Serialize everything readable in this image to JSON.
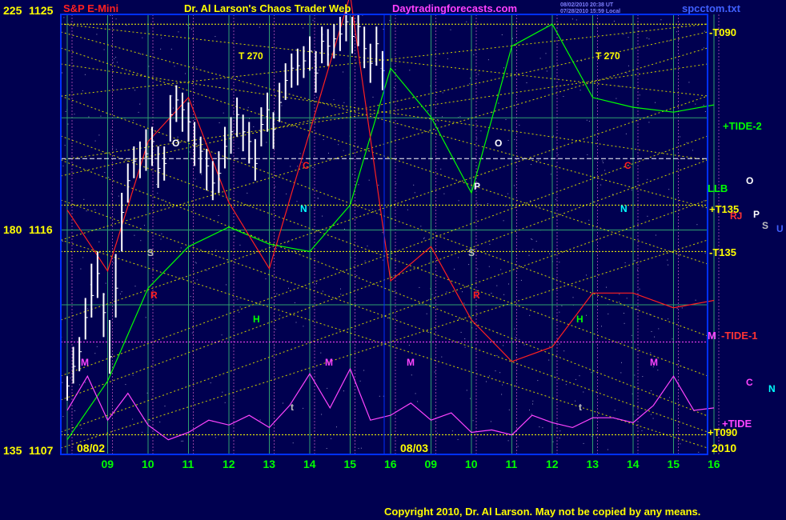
{
  "chart_data": {
    "type": "bar",
    "title": "Dr. Al Larson's Chaos Trader Web",
    "site": "Daytradingforecasts.com",
    "instrument": "S&P E-Mini",
    "file_name": "spcctom.txt",
    "header_timestamps": [
      "08/02/2010 20:38 UT",
      "07/28/2010 15:59 Local"
    ],
    "copyright": "Copyright 2010, Dr. Al Larson. May not be copied by any means.",
    "year": "2010",
    "date_labels": [
      "08/02",
      "08/03"
    ],
    "x_ticks": [
      "09",
      "10",
      "11",
      "12",
      "13",
      "14",
      "15",
      "16",
      "09",
      "10",
      "11",
      "12",
      "13",
      "14",
      "15",
      "16"
    ],
    "y_left_labels": [
      {
        "angle": "225",
        "price": 1125
      },
      {
        "angle": "180",
        "price": 1116
      },
      {
        "angle": "135",
        "price": 1107
      }
    ],
    "ylim": [
      1107,
      1125
    ],
    "right_labels": [
      {
        "text": "-T090",
        "color": "#ffff00"
      },
      {
        "text": "+TIDE-2",
        "color": "#00ff00"
      },
      {
        "text": "LLB",
        "color": "#00ff00"
      },
      {
        "text": "+T135",
        "color": "#ffff00"
      },
      {
        "text": "-T135",
        "color": "#ffff00"
      },
      {
        "text": "M",
        "color": "#ff44ff"
      },
      {
        "text": "-TIDE-1",
        "color": "#ff3333"
      },
      {
        "text": "+TIDE",
        "color": "#ff44ff"
      },
      {
        "text": "+T090",
        "color": "#ffff00"
      }
    ],
    "right_planet_glyphs": [
      {
        "text": "O",
        "color": "#ffffff"
      },
      {
        "text": "RJ",
        "color": "#ff3333"
      },
      {
        "text": "P",
        "color": "#ffffff"
      },
      {
        "text": "S",
        "color": "#c0c0c0"
      },
      {
        "text": "U",
        "color": "#4060ff"
      },
      {
        "text": "C",
        "color": "#ff44ff"
      },
      {
        "text": "N",
        "color": "#00ffff"
      }
    ],
    "plot_letters": [
      {
        "text": "T 270",
        "color": "#ffff00"
      },
      {
        "text": "T 270",
        "color": "#ffff00"
      },
      {
        "text": "O",
        "color": "#ffffff"
      },
      {
        "text": "O",
        "color": "#ffffff"
      },
      {
        "text": "C",
        "color": "#ff2020"
      },
      {
        "text": "C",
        "color": "#ff2020"
      },
      {
        "text": "N",
        "color": "#00ffff"
      },
      {
        "text": "N",
        "color": "#00ffff"
      },
      {
        "text": "S",
        "color": "#c0c0c0"
      },
      {
        "text": "S",
        "color": "#c0c0c0"
      },
      {
        "text": "P",
        "color": "#ffffff"
      },
      {
        "text": "R",
        "color": "#ff2020"
      },
      {
        "text": "R",
        "color": "#ff2020"
      },
      {
        "text": "H",
        "color": "#00ff00"
      },
      {
        "text": "H",
        "color": "#00ff00"
      },
      {
        "text": "M",
        "color": "#ff44ff"
      },
      {
        "text": "M",
        "color": "#ff44ff"
      },
      {
        "text": "M",
        "color": "#ff44ff"
      },
      {
        "text": "M",
        "color": "#ff44ff"
      },
      {
        "text": "t",
        "color": "#c0c0c0"
      },
      {
        "text": "t",
        "color": "#c0c0c0"
      }
    ],
    "price_series": {
      "name": "",
      "color": "#ffffff",
      "x": [
        0.0,
        0.15,
        0.3,
        0.45,
        0.6,
        0.75,
        0.9,
        1.05,
        1.2,
        1.35,
        1.5,
        1.65,
        1.8,
        1.95,
        2.1,
        2.25,
        2.4,
        2.55,
        2.7,
        2.85,
        3.0,
        3.15,
        3.3,
        3.45,
        3.6,
        3.75,
        3.9,
        4.05,
        4.2,
        4.35,
        4.5,
        4.65,
        4.8,
        4.95,
        5.1,
        5.25,
        5.4,
        5.55,
        5.7,
        5.85,
        6.0,
        6.15,
        6.3,
        6.45,
        6.6,
        6.75,
        6.9,
        7.05,
        7.2,
        7.35,
        7.5,
        7.65,
        7.8
      ],
      "close": [
        1109.8,
        1110.6,
        1111.2,
        1112.6,
        1113.5,
        1114.4,
        1112.8,
        1111.0,
        1113.8,
        1116.9,
        1118.2,
        1119.0,
        1119.1,
        1119.3,
        1119.8,
        1118.7,
        1118.9,
        1120.9,
        1121.5,
        1121.1,
        1120.6,
        1119.7,
        1119.4,
        1118.8,
        1118.1,
        1118.5,
        1119.6,
        1120.2,
        1120.9,
        1120.2,
        1119.8,
        1118.9,
        1120.5,
        1121.1,
        1120.3,
        1121.4,
        1122.3,
        1122.8,
        1122.9,
        1123.1,
        1123.5,
        1122.6,
        1123.9,
        1123.7,
        1124.0,
        1124.2,
        1124.7,
        1124.1,
        1124.5,
        1123.6,
        1123.0,
        1123.8,
        1122.7
      ],
      "high": [
        1110.2,
        1111.4,
        1111.8,
        1113.4,
        1114.8,
        1115.3,
        1113.6,
        1112.5,
        1115.2,
        1117.7,
        1118.9,
        1119.6,
        1119.8,
        1120.3,
        1120.4,
        1119.6,
        1119.6,
        1121.7,
        1122.1,
        1121.8,
        1121.4,
        1120.6,
        1120.0,
        1119.5,
        1119.0,
        1119.4,
        1120.4,
        1120.8,
        1121.6,
        1120.9,
        1120.6,
        1119.9,
        1121.2,
        1121.8,
        1121.0,
        1122.2,
        1123.0,
        1123.4,
        1123.6,
        1123.7,
        1124.1,
        1123.5,
        1124.5,
        1124.4,
        1124.6,
        1124.9,
        1125.3,
        1124.9,
        1125.0,
        1124.5,
        1123.8,
        1124.5,
        1123.5
      ],
      "low": [
        1109.2,
        1109.9,
        1110.4,
        1111.7,
        1112.6,
        1113.4,
        1111.8,
        1110.3,
        1112.6,
        1115.3,
        1117.3,
        1118.3,
        1118.3,
        1118.6,
        1118.8,
        1117.9,
        1118.2,
        1119.8,
        1120.6,
        1120.2,
        1119.8,
        1118.8,
        1118.5,
        1117.8,
        1117.4,
        1117.7,
        1118.7,
        1119.3,
        1120.0,
        1119.4,
        1118.9,
        1118.2,
        1119.6,
        1120.2,
        1119.5,
        1120.6,
        1121.5,
        1122.0,
        1122.1,
        1122.4,
        1122.7,
        1121.8,
        1123.0,
        1122.9,
        1123.2,
        1123.5,
        1123.9,
        1123.4,
        1123.7,
        1122.8,
        1122.2,
        1122.9,
        1121.9
      ]
    },
    "series": [
      {
        "name": "+TIDE-2",
        "color": "#00ff00",
        "x": [
          0,
          1,
          2,
          3,
          4,
          5,
          6,
          7,
          8,
          9,
          10,
          11,
          12,
          13,
          14,
          15,
          16
        ],
        "y": [
          1107.6,
          1110.0,
          1113.8,
          1115.5,
          1116.3,
          1115.6,
          1115.3,
          1117.2,
          1122.8,
          1120.8,
          1117.7,
          1123.7,
          1124.6,
          1121.6,
          1121.2,
          1121.0,
          1121.3
        ]
      },
      {
        "name": "-TIDE-1",
        "color": "#ff2020",
        "x": [
          0,
          1,
          2,
          3,
          4,
          5,
          6,
          7,
          8,
          9,
          10,
          11,
          12,
          13,
          14,
          15,
          16
        ],
        "y": [
          1117.0,
          1114.5,
          1119.8,
          1121.6,
          1117.3,
          1114.6,
          1120.2,
          1125.8,
          1114.1,
          1115.5,
          1112.5,
          1110.8,
          1111.4,
          1113.6,
          1113.6,
          1113.0,
          1113.3
        ]
      },
      {
        "name": "+TIDE",
        "color": "#ff44ff",
        "x": [
          0,
          0.5,
          1,
          1.5,
          2,
          2.5,
          3,
          3.5,
          4,
          4.5,
          5,
          5.5,
          6,
          6.5,
          7,
          7.5,
          8,
          8.5,
          9,
          9.5,
          10,
          10.5,
          11,
          11.5,
          12,
          12.5,
          13,
          13.5,
          14,
          14.5,
          15,
          15.5,
          16
        ],
        "y": [
          1108.8,
          1110.2,
          1108.4,
          1109.5,
          1108.2,
          1107.6,
          1107.9,
          1108.4,
          1108.2,
          1108.6,
          1108.1,
          1109.0,
          1110.3,
          1108.9,
          1110.5,
          1108.4,
          1108.6,
          1109.1,
          1108.4,
          1108.7,
          1107.9,
          1108.0,
          1107.8,
          1108.6,
          1108.3,
          1108.1,
          1108.5,
          1108.5,
          1108.3,
          1109.0,
          1110.2,
          1108.8,
          1108.9
        ]
      }
    ],
    "level_lines": [
      {
        "name": "-T090",
        "price": 1124.6,
        "color": "#ffff00",
        "style": "dotted"
      },
      {
        "name": "LLB",
        "price": 1119.1,
        "color": "#ffffff",
        "style": "dashed"
      },
      {
        "name": "+T135",
        "price": 1117.2,
        "color": "#ffff00",
        "style": "dotted"
      },
      {
        "name": "-T135",
        "price": 1115.3,
        "color": "#ffff00",
        "style": "dotted"
      },
      {
        "name": "M",
        "price": 1111.6,
        "color": "#ff44ff",
        "style": "dotted"
      },
      {
        "name": "+T090",
        "price": 1107.8,
        "color": "#ffff00",
        "style": "dotted"
      }
    ],
    "grid": true
  }
}
